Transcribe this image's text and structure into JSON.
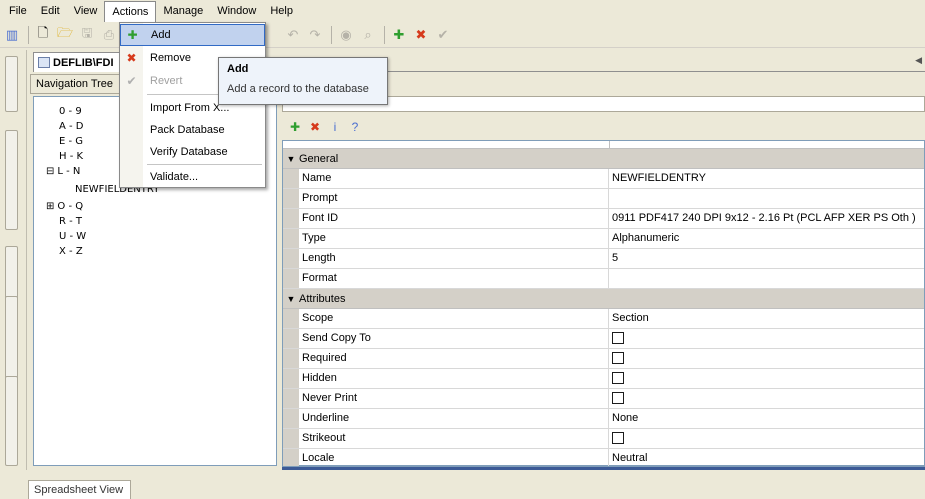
{
  "menubar": {
    "items": [
      "File",
      "Edit",
      "View",
      "Actions",
      "Manage",
      "Window",
      "Help"
    ]
  },
  "doc_tab": {
    "title": "DEFLIB\\FDI"
  },
  "nav": {
    "header": "Navigation Tree",
    "nodes": [
      "0 - 9",
      "A - D",
      "E - G",
      "H - K",
      "L - N",
      "NEWFIELDENTRY",
      "O - Q",
      "R - T",
      "U - W",
      "X - Z"
    ],
    "expander_minus": "⊟",
    "expander_plus": "⊞"
  },
  "actions_menu": {
    "items": [
      "Add",
      "Remove",
      "Revert",
      "Import From X...",
      "Pack Database",
      "Verify Database",
      "Validate..."
    ]
  },
  "tooltip": {
    "title": "Add",
    "body": "Add a record to the database"
  },
  "properties": {
    "general_label": "General",
    "general": [
      {
        "name": "Name",
        "value": "NEWFIELDENTRY"
      },
      {
        "name": "Prompt",
        "value": ""
      },
      {
        "name": "Font ID",
        "value": "0911 PDF417 240 DPI 9x12 - 2.16 Pt (PCL AFP XER PS Oth )"
      },
      {
        "name": "Type",
        "value": "Alphanumeric"
      },
      {
        "name": "Length",
        "value": "5"
      },
      {
        "name": "Format",
        "value": ""
      }
    ],
    "attributes_label": "Attributes",
    "attributes": [
      {
        "name": "Scope",
        "value": "Section"
      },
      {
        "name": "Send Copy To",
        "value": ""
      },
      {
        "name": "Required",
        "value": ""
      },
      {
        "name": "Hidden",
        "value": ""
      },
      {
        "name": "Never Print",
        "value": ""
      },
      {
        "name": "Underline",
        "value": "None"
      },
      {
        "name": "Strikeout",
        "value": ""
      },
      {
        "name": "Locale",
        "value": "Neutral"
      }
    ]
  },
  "bottom_tab": "Spreadsheet View",
  "icons": {
    "add": "✚",
    "remove": "✖",
    "revert": "✔",
    "question": "?",
    "info": "i"
  }
}
